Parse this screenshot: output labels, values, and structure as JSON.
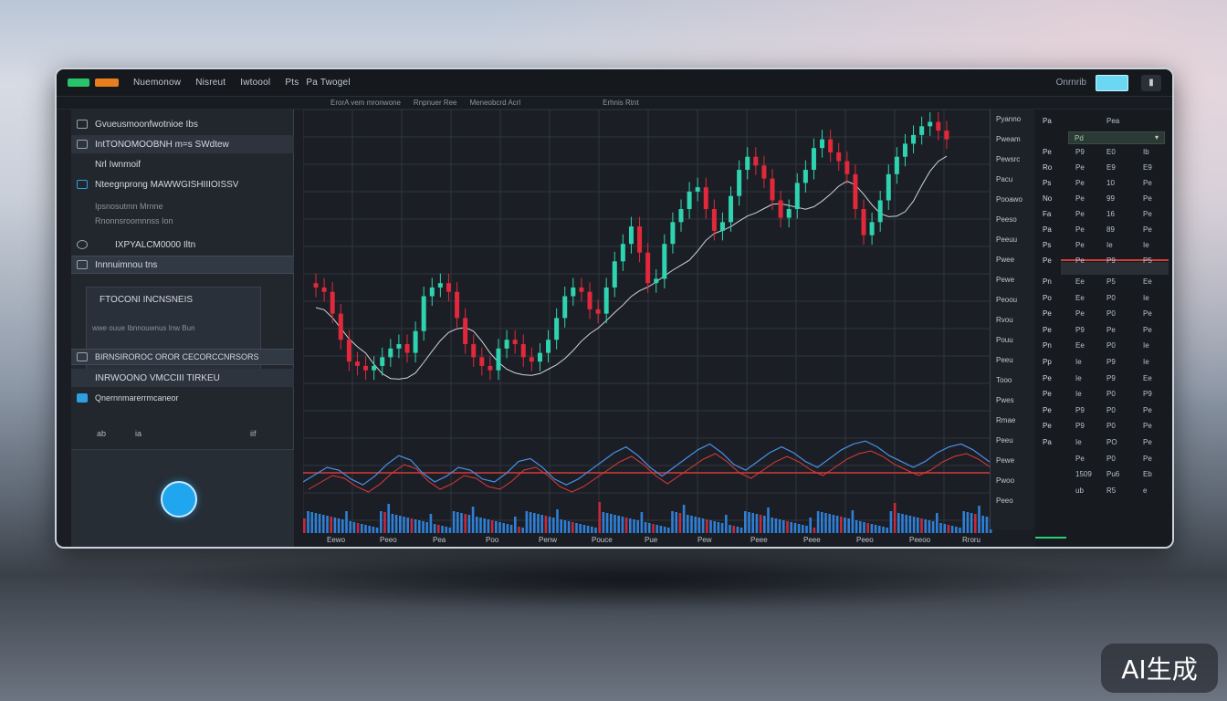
{
  "topbar": {
    "menu": [
      "Nuemonow",
      "Nisreut",
      "Iwtoool",
      "Pts",
      "Pa Twogel"
    ],
    "search_label": "Onrnrib",
    "menu_icon": "more-icon"
  },
  "subbar": {
    "items": [
      "ErorA vem mronwone",
      "Rnpnuer Ree",
      "Meneobcrd Acrl",
      "Erhnis Rtnt"
    ]
  },
  "sidebar": {
    "rows": [
      {
        "text": "Gvueusmoonfwotnioe Ibs"
      },
      {
        "text": "IntTONOMOOBNH m=s SWdtew"
      },
      {
        "text": "Nrl Iwnmoif"
      },
      {
        "text": "Nteegnprong MAWWGISHIIIOISSV"
      },
      {
        "text": "Ipsnosutmn Mrnne"
      },
      {
        "text": "Rnonnsroomnnss Ion"
      },
      {
        "text": "IXPYALCM0000 Iltn"
      },
      {
        "text": "Innnuimnou tns"
      },
      {
        "text": "FTOCONI INCNSNEIS"
      },
      {
        "text": "wwe ouue Ibnnouwnus Inw Bun"
      },
      {
        "text": "BIRNSIROROC OROR CECORCCNRSORS"
      },
      {
        "text": "INRWOONO VMCCIII TIRKEU"
      },
      {
        "text": "Qnernnmarerrmcaneor"
      }
    ],
    "icons": [
      "ab",
      "ia",
      "iif"
    ]
  },
  "price_axis": [
    "Pyanno",
    "Pweam",
    "Pewsrc",
    "Pacu",
    "Pooawo",
    "Peeso",
    "Peeuu",
    "Pwee",
    "Pewe",
    "Peoou",
    "Rvou",
    "Pouu",
    "Peeu",
    "Tooo",
    "Pwes",
    "Rmae",
    "Peeu",
    "Pewe",
    "Pwoo",
    "Peeo"
  ],
  "orderbook": {
    "selector": "Pd",
    "rows": [
      [
        "Pa",
        "",
        "Pea",
        ""
      ],
      [
        "Pe",
        "P9",
        "E0",
        "Ib"
      ],
      [
        "Ro",
        "Pe",
        "E9",
        "E9"
      ],
      [
        "Ps",
        "Pe",
        "10",
        "Pe"
      ],
      [
        "No",
        "Pe",
        "99",
        "Pe"
      ],
      [
        "Fa",
        "Pe",
        "16",
        "Pe"
      ],
      [
        "Pa",
        "Pe",
        "89",
        "Pe"
      ],
      [
        "Ps",
        "Pe",
        "Ie",
        "Ie"
      ],
      [
        "Pe",
        "Pe",
        "P9",
        "P5"
      ],
      [
        "Pn",
        "Ee",
        "P5",
        "Ee"
      ],
      [
        "Po",
        "Ee",
        "P0",
        "Ie"
      ],
      [
        "Pe",
        "Pe",
        "P0",
        "Pe"
      ],
      [
        "Pe",
        "P9",
        "Pe",
        "Pe"
      ],
      [
        "Pn",
        "Ee",
        "P0",
        "Ie"
      ],
      [
        "Pp",
        "Ie",
        "P9",
        "Ie"
      ],
      [
        "Pe",
        "Ie",
        "P9",
        "Ee"
      ],
      [
        "Pe",
        "Ie",
        "P0",
        "P9"
      ],
      [
        "Pe",
        "P9",
        "P0",
        "Pe"
      ],
      [
        "Pe",
        "P9",
        "P0",
        "Pe"
      ],
      [
        "Pa",
        "Ie",
        "PO",
        "Pe"
      ],
      [
        "",
        "Pe",
        "P0",
        "Pe"
      ],
      [
        "",
        "1509",
        "Pu6",
        "Eb"
      ],
      [
        "",
        "ub",
        "R5",
        "e"
      ]
    ]
  },
  "time_axis": [
    "Eewo",
    "Peeo",
    "Pea",
    "Poo",
    "Penw",
    "Pouce",
    "Pue",
    "Pew",
    "Peee",
    "Peee",
    "Peeo",
    "Peeoo",
    "Rroru"
  ],
  "chart_data": {
    "type": "candlestick",
    "title": "",
    "series": [
      {
        "name": "",
        "values": [
          62,
          61,
          56,
          50,
          45,
          44,
          43,
          44,
          46,
          48,
          49,
          47,
          52,
          60,
          62,
          63,
          61,
          55,
          49,
          46,
          44,
          43,
          48,
          50,
          49,
          46,
          45,
          47,
          50,
          55,
          60,
          62,
          61,
          57,
          56,
          62,
          68,
          72,
          76,
          70,
          63,
          64,
          72,
          77,
          80,
          84,
          85,
          80,
          75,
          77,
          83,
          89,
          92,
          90,
          87,
          82,
          78,
          80,
          86,
          89,
          94,
          96,
          93,
          91,
          88,
          80,
          74,
          77,
          82,
          88,
          92,
          95,
          97,
          99,
          100,
          98,
          96
        ]
      }
    ],
    "oscillator": [
      20,
      25,
      30,
      28,
      22,
      18,
      24,
      32,
      38,
      35,
      26,
      20,
      24,
      30,
      28,
      22,
      20,
      26,
      34,
      36,
      30,
      22,
      18,
      22,
      28,
      34,
      40,
      44,
      38,
      30,
      24,
      30,
      36,
      42,
      46,
      40,
      32,
      28,
      34,
      40,
      44,
      40,
      34,
      30,
      36,
      42,
      46,
      48,
      44,
      38,
      34,
      30,
      34,
      40,
      44,
      46,
      42,
      36,
      30
    ]
  },
  "watermark": "AI生成",
  "colors": {
    "up": "#2fd3b0",
    "down": "#e2283a",
    "grid": "#2f3640",
    "accent": "#1fa6ef"
  }
}
